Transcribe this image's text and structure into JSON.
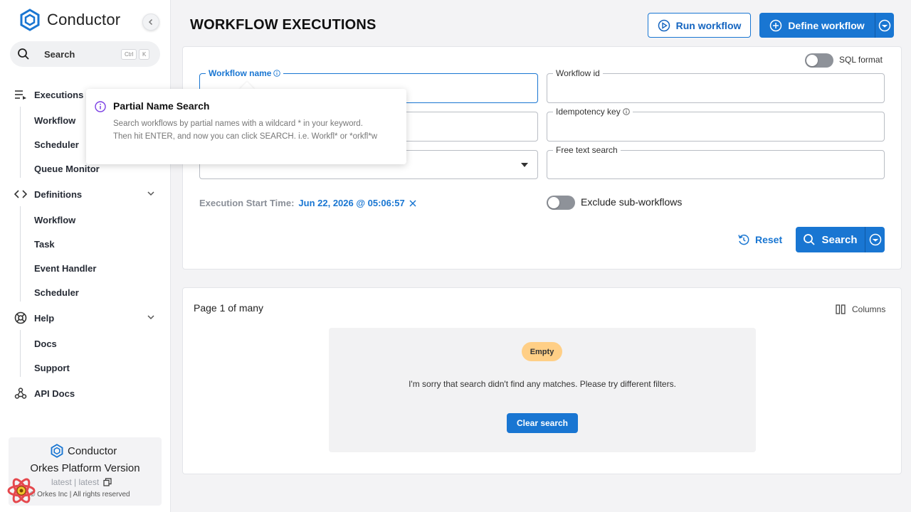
{
  "brand": {
    "name": "Conductor"
  },
  "sidebar": {
    "search": {
      "label": "Search",
      "shortcut_mod": "Ctrl",
      "shortcut_key": "K"
    },
    "executions": {
      "label": "Executions",
      "items": [
        "Workflow",
        "Scheduler",
        "Queue Monitor"
      ]
    },
    "definitions": {
      "label": "Definitions",
      "items": [
        "Workflow",
        "Task",
        "Event Handler",
        "Scheduler"
      ]
    },
    "help": {
      "label": "Help",
      "items": [
        "Docs",
        "Support"
      ]
    },
    "api_docs": {
      "label": "API Docs"
    },
    "footer": {
      "brand": "Conductor",
      "platform_version": "Orkes Platform Version",
      "versions": "latest | latest",
      "copyright": "© Orkes Inc | All rights reserved"
    }
  },
  "header": {
    "title": "WORKFLOW EXECUTIONS",
    "run_workflow": "Run workflow",
    "define_workflow": "Define workflow"
  },
  "filters": {
    "sql_format_label": "SQL format",
    "workflow_name_label": "Workflow name",
    "workflow_id_label": "Workflow id",
    "idempotency_key_label": "Idempotency key",
    "free_text_label": "Free text search",
    "start_time_label": "Execution Start Time:",
    "start_time_value": "Jun 22, 2026 @ 05:06:57",
    "exclude_sub_label": "Exclude sub-workflows",
    "reset": "Reset",
    "search": "Search"
  },
  "tooltip": {
    "title": "Partial Name Search",
    "body": "Search workflows by partial names with a wildcard * in your keyword. Then hit ENTER, and now you can click SEARCH. i.e. Workfl* or *orkfl*w"
  },
  "results": {
    "page_info": "Page 1 of many",
    "columns": "Columns",
    "empty_badge": "Empty",
    "empty_message": "I'm sorry that search didn't find any matches. Please try different filters.",
    "clear_search": "Clear search"
  },
  "colors": {
    "accent": "#1976d2",
    "empty_badge": "#ffcf86"
  }
}
